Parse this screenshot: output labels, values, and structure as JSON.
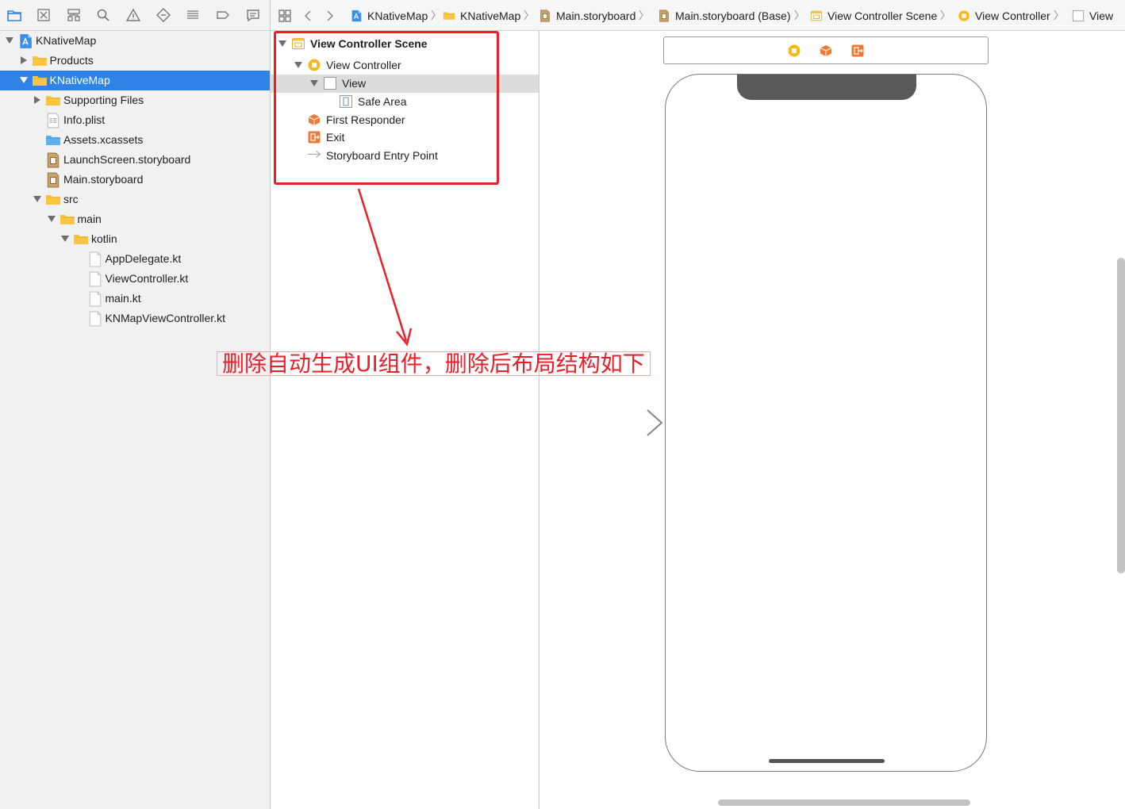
{
  "navigator": {
    "items": [
      {
        "label": "KNativeMap",
        "icon": "project-icon"
      },
      {
        "label": "Products",
        "icon": "folder-icon"
      },
      {
        "label": "KNativeMap",
        "icon": "folder-icon"
      },
      {
        "label": "Supporting Files",
        "icon": "folder-icon"
      },
      {
        "label": "Info.plist",
        "icon": "plist-icon"
      },
      {
        "label": "Assets.xcassets",
        "icon": "assets-folder-icon"
      },
      {
        "label": "LaunchScreen.storyboard",
        "icon": "storyboard-icon"
      },
      {
        "label": "Main.storyboard",
        "icon": "storyboard-icon"
      },
      {
        "label": "src",
        "icon": "folder-icon"
      },
      {
        "label": "main",
        "icon": "folder-icon"
      },
      {
        "label": "kotlin",
        "icon": "folder-icon"
      },
      {
        "label": "AppDelegate.kt",
        "icon": "file-icon"
      },
      {
        "label": "ViewController.kt",
        "icon": "file-icon"
      },
      {
        "label": "main.kt",
        "icon": "file-icon"
      },
      {
        "label": "KNMapViewController.kt",
        "icon": "file-icon"
      }
    ],
    "selected_label": "KNativeMap"
  },
  "jumpbar": {
    "crumbs": [
      {
        "label": "KNativeMap",
        "icon": "project-icon"
      },
      {
        "label": "KNativeMap",
        "icon": "folder-icon"
      },
      {
        "label": "Main.storyboard",
        "icon": "storyboard-icon"
      },
      {
        "label": "Main.storyboard (Base)",
        "icon": "storyboard-icon"
      },
      {
        "label": "View Controller Scene",
        "icon": "scene-icon"
      },
      {
        "label": "View Controller",
        "icon": "view-controller-icon"
      },
      {
        "label": "View",
        "icon": "view-icon"
      }
    ]
  },
  "outline": {
    "items": [
      {
        "label": "View Controller Scene",
        "icon": "scene-icon"
      },
      {
        "label": "View Controller",
        "icon": "view-controller-icon"
      },
      {
        "label": "View",
        "icon": "view-icon"
      },
      {
        "label": "Safe Area",
        "icon": "safe-area-icon"
      },
      {
        "label": "First Responder",
        "icon": "first-responder-icon"
      },
      {
        "label": "Exit",
        "icon": "exit-icon"
      },
      {
        "label": "Storyboard Entry Point",
        "icon": "entry-arrow-icon"
      }
    ]
  },
  "annotation": {
    "text": "删除自动生成UI组件，删除后布局结构如下",
    "color": "#e8202a"
  },
  "colors": {
    "selection": "#2f83e7",
    "folder": "#f8c643",
    "orange": "#f07a34"
  }
}
